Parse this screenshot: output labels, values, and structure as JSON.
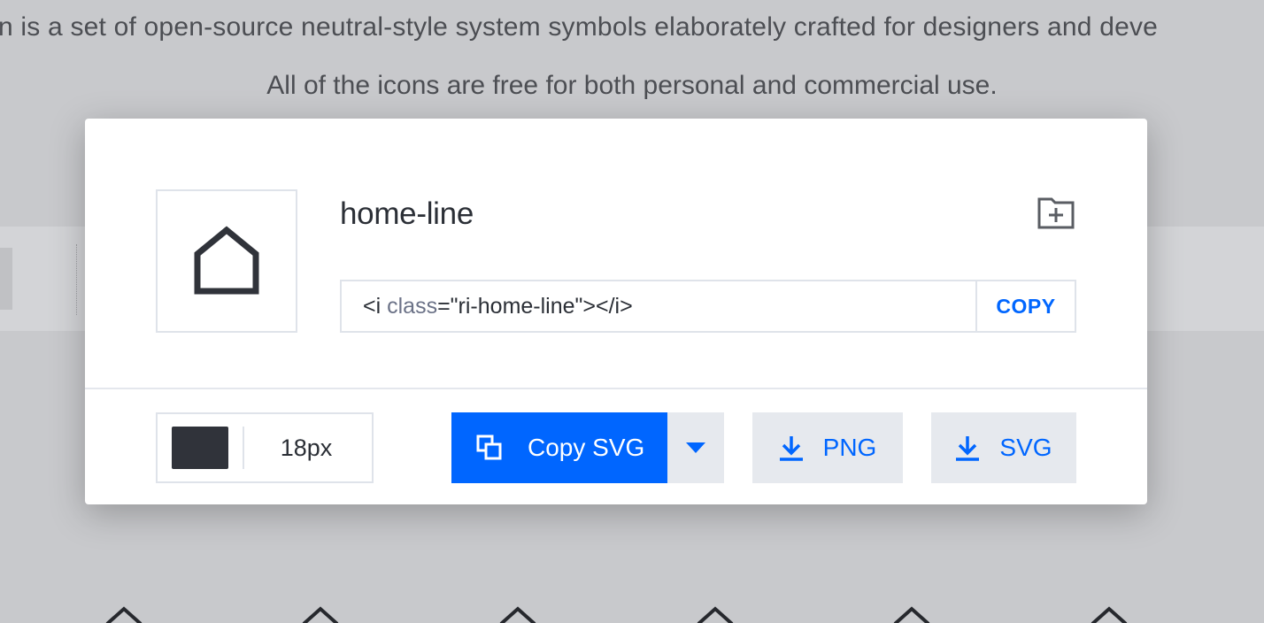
{
  "background": {
    "intro_line_1": "n is a set of open-source neutral-style system symbols elaborately crafted for designers and deve",
    "intro_line_2": "All of the icons are free for both personal and commercial use."
  },
  "modal": {
    "icon_name": "home-line",
    "preview_icon": "home-line-icon",
    "collect_icon": "folder-add-icon",
    "code": {
      "prefix": "<i ",
      "attr": "class",
      "suffix": "=\"ri-home-line\"></i>"
    },
    "copy_code_label": "COPY",
    "color": {
      "swatch": "#30333a"
    },
    "size_value": "18px",
    "copy_svg_label": "Copy SVG",
    "download_png_label": "PNG",
    "download_svg_label": "SVG"
  },
  "colors": {
    "accent": "#0066ff",
    "icon": "#30333a",
    "border": "#dfe3ea",
    "button_grey": "#e6e9ee",
    "backdrop": "#c8c9cc"
  }
}
